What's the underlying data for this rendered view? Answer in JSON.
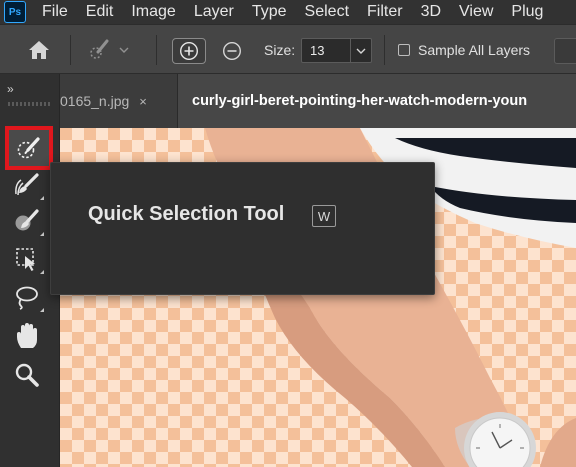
{
  "app": {
    "logo_text": "Ps",
    "accent_color": "#31a8ff"
  },
  "menu": {
    "items": [
      "File",
      "Edit",
      "Image",
      "Layer",
      "Type",
      "Select",
      "Filter",
      "3D",
      "View",
      "Plug"
    ]
  },
  "options_bar": {
    "home_icon": "home-icon",
    "brush_preset_icon": "brush-preset-icon",
    "add_to_selection_icon": "add-selection-icon",
    "subtract_from_selection_icon": "subtract-selection-icon",
    "size_label": "Size:",
    "size_value": "13",
    "sample_all_layers_label": "Sample All Layers",
    "sample_all_layers_checked": false
  },
  "toolbar": {
    "collapse_label": "»",
    "highlight_color": "#e0171d",
    "tools": [
      {
        "icon": "quick-selection-icon",
        "selected": true
      },
      {
        "icon": "mixer-brush-icon",
        "selected": false
      },
      {
        "icon": "brush-icon",
        "selected": false
      },
      {
        "icon": "marquee-transform-icon",
        "selected": false
      },
      {
        "icon": "lasso-icon",
        "selected": false
      },
      {
        "icon": "hand-icon",
        "selected": false
      },
      {
        "icon": "zoom-icon",
        "selected": false
      }
    ]
  },
  "tabs": [
    {
      "label": "0165_n.jpg",
      "close": "×",
      "active": false
    },
    {
      "label": "curly-girl-beret-pointing-her-watch-modern-youn",
      "active": true
    }
  ],
  "tooltip": {
    "title": "Quick Selection Tool",
    "shortcut": "W"
  }
}
